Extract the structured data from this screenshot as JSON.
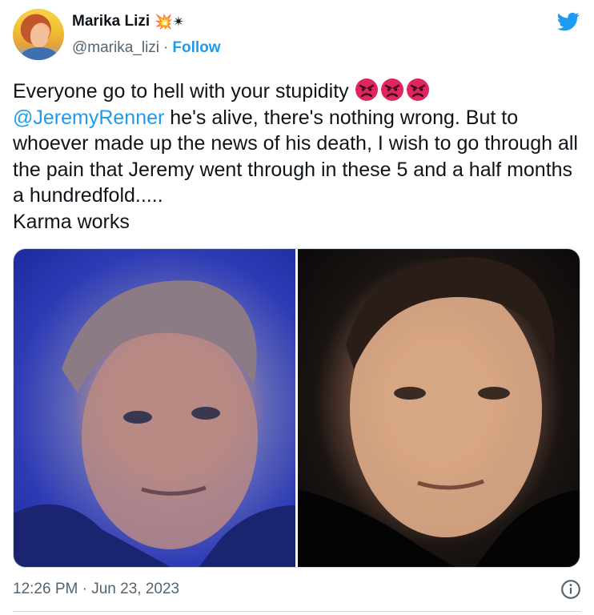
{
  "author": {
    "display_name": "Marika Lizi",
    "name_emojis": "💥✴",
    "handle": "@marika_lizi",
    "separator": "·",
    "follow_label": "Follow"
  },
  "tweet": {
    "line1": "Everyone go to hell with your stupidity",
    "angry_emoji": "😡",
    "mention": "@JeremyRenner",
    "line2_rest": " he's alive, there's nothing wrong. But to whoever made up the news of his death, I wish to go through all the pain that Jeremy went through in these 5 and a half months a hundredfold.....",
    "line_last": "Karma works"
  },
  "media": {
    "photos": [
      "photo-left",
      "photo-right"
    ]
  },
  "footer": {
    "timestamp": "12:26 PM · Jun 23, 2023"
  },
  "colors": {
    "brand_blue": "#1d9bf0",
    "text_primary": "#0f1419",
    "text_secondary": "#536471",
    "angry_red": "#e0245e"
  },
  "icons": {
    "logo": "twitter-bird-icon",
    "info": "info-icon"
  }
}
